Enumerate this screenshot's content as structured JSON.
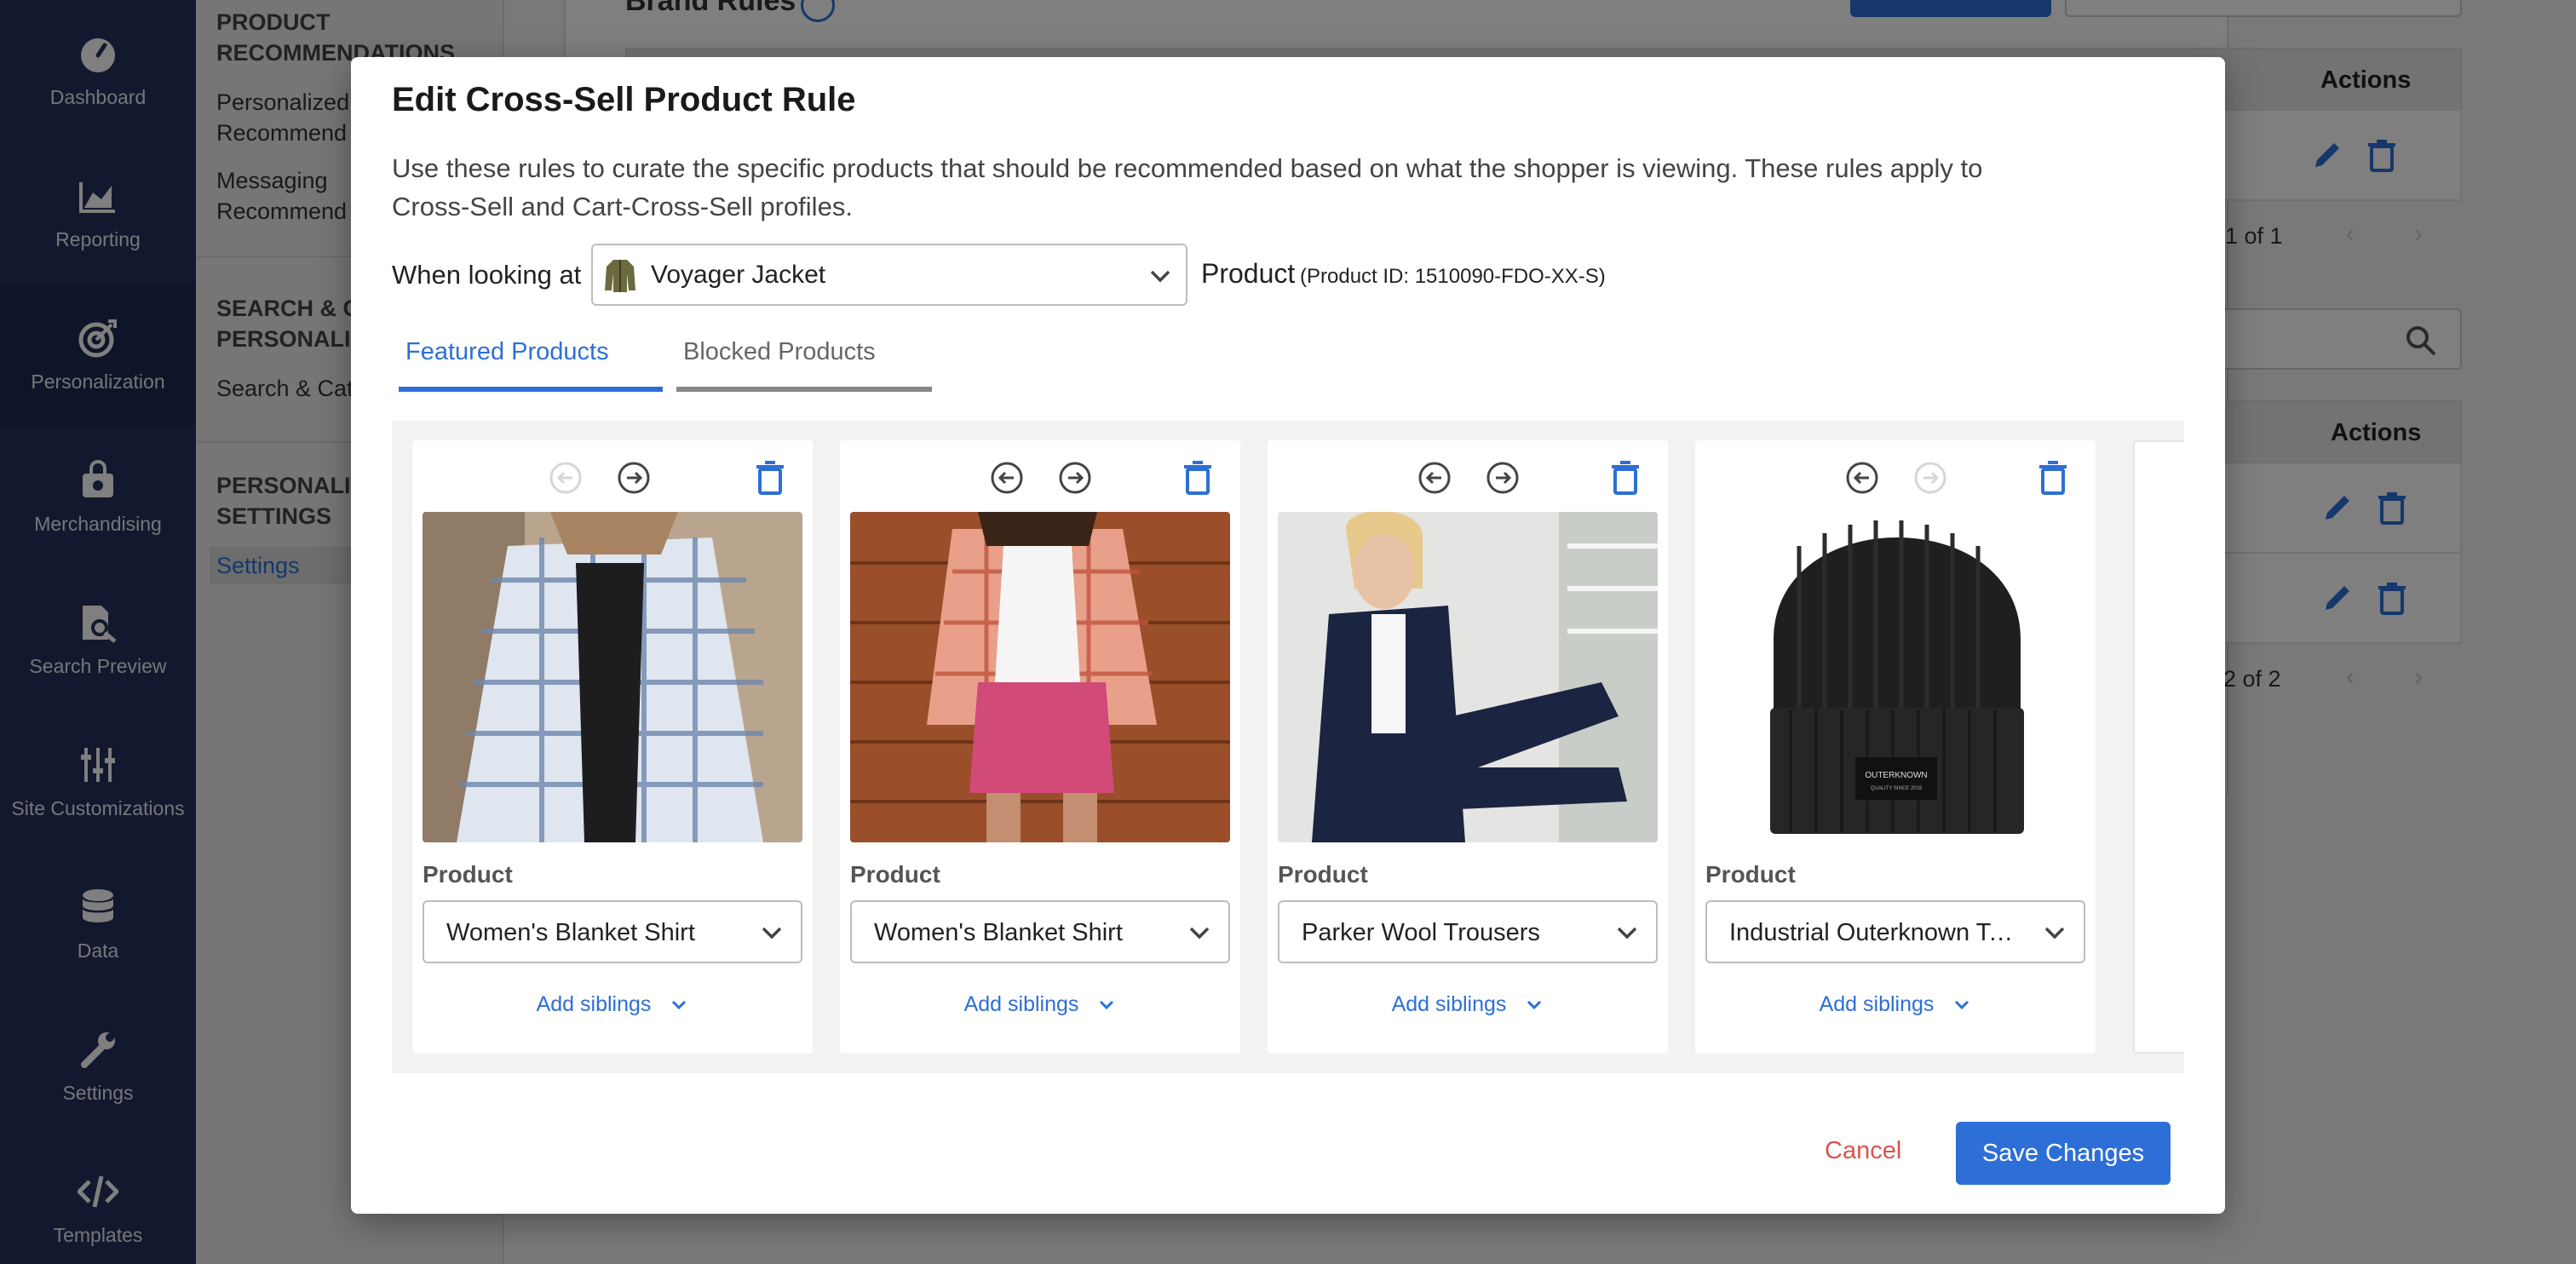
{
  "nav": {
    "items": [
      {
        "label": "Dashboard",
        "icon": "gauge-icon"
      },
      {
        "label": "Reporting",
        "icon": "chart-icon"
      },
      {
        "label": "Personalization",
        "icon": "target-icon",
        "active": true
      },
      {
        "label": "Merchandising",
        "icon": "bag-icon"
      },
      {
        "label": "Search Preview",
        "icon": "doc-search-icon"
      },
      {
        "label": "Site Customizations",
        "icon": "sliders-icon"
      },
      {
        "label": "Data",
        "icon": "database-icon"
      },
      {
        "label": "Settings",
        "icon": "wrench-icon"
      },
      {
        "label": "Templates",
        "icon": "code-icon"
      }
    ]
  },
  "sidebar": {
    "section1": "PRODUCT\nRECOMMENDATIONS",
    "link1": "Personalized\nRecommend",
    "link2": "Messaging\nRecommend",
    "section2": "SEARCH & C\nPERSONALIZ",
    "link3": "Search & Cat",
    "section3": "PERSONALIZ\nSETTINGS",
    "link4": "Settings"
  },
  "background": {
    "title": "Brand Rules",
    "actions_header": "Actions",
    "pager1": "1 of 1",
    "pager2": "2 of 2"
  },
  "modal": {
    "title": "Edit Cross-Sell Product Rule",
    "description": "Use these rules to curate the specific products that should be recommended based on what the shopper is viewing. These rules apply to Cross-Sell and Cart-Cross-Sell profiles.",
    "when_label": "When looking at",
    "selected_product": "Voyager Jacket",
    "product_label": "Product",
    "product_id": "(Product ID: 1510090-FDO-XX-S)",
    "tabs": [
      {
        "label": "Featured Products",
        "active": true
      },
      {
        "label": "Blocked Products",
        "active": false
      }
    ],
    "cards": [
      {
        "product_label": "Product",
        "product": "Women's Blanket Shirt",
        "siblings": "Add siblings"
      },
      {
        "product_label": "Product",
        "product": "Women's Blanket Shirt",
        "siblings": "Add siblings"
      },
      {
        "product_label": "Product",
        "product": "Parker Wool Trousers",
        "siblings": "Add siblings"
      },
      {
        "product_label": "Product",
        "product": "Industrial Outerknown Tall Beanie",
        "siblings": "Add siblings"
      }
    ],
    "cancel": "Cancel",
    "save": "Save Changes"
  },
  "colors": {
    "nav_bg": "#25325d",
    "accent": "#2d6fd6",
    "danger": "#d9534f"
  }
}
